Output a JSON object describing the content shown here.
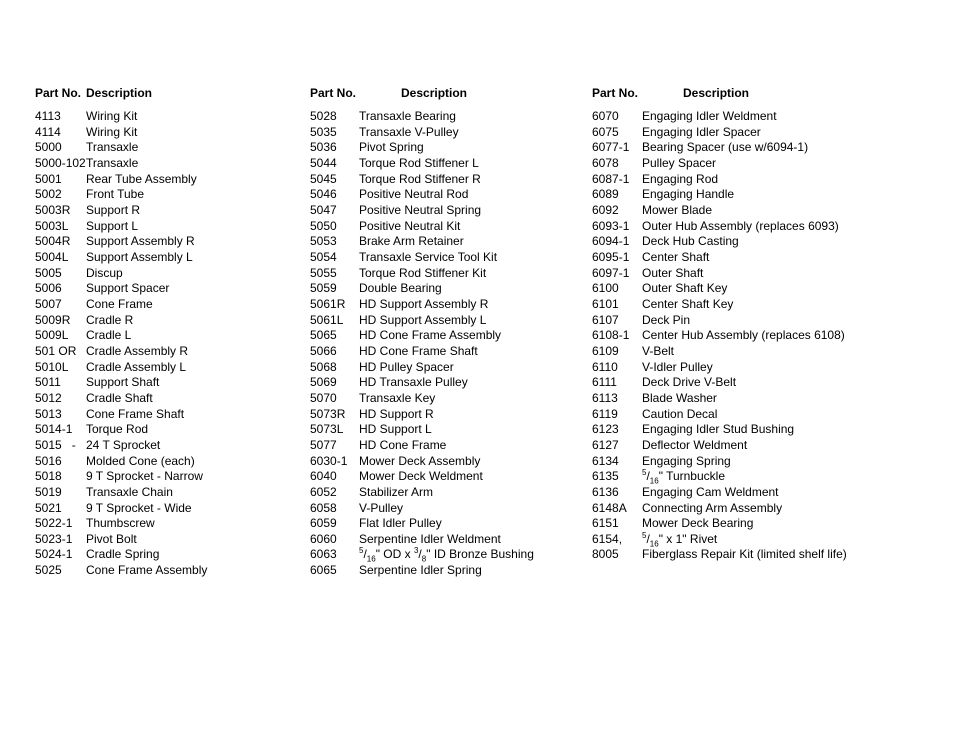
{
  "columns": [
    {
      "header_part": "Part No.",
      "header_desc": "Description",
      "rows": [
        {
          "part": "4113",
          "desc": "Wiring Kit"
        },
        {
          "part": "4114",
          "desc": "Wiring Kit"
        },
        {
          "part": "5000",
          "desc": "Transaxle"
        },
        {
          "part": "5000-102",
          "desc": "Transaxle"
        },
        {
          "part": "5001",
          "desc": "Rear Tube Assembly"
        },
        {
          "part": "5002",
          "desc": "Front Tube"
        },
        {
          "part": "5003R",
          "desc": "Support R"
        },
        {
          "part": "5003L",
          "desc": "Support L"
        },
        {
          "part": "5004R",
          "desc": "Support Assembly R"
        },
        {
          "part": "5004L",
          "desc": "Support Assembly L"
        },
        {
          "part": "5005",
          "desc": "Discup"
        },
        {
          "part": "5006",
          "desc": "Support Spacer"
        },
        {
          "part": "5007",
          "desc": "Cone Frame"
        },
        {
          "part": "5009R",
          "desc": "Cradle R"
        },
        {
          "part": "5009L",
          "desc": "Cradle L"
        },
        {
          "part": "501 OR",
          "desc": "Cradle Assembly R"
        },
        {
          "part": "5010L",
          "desc": "Cradle Assembly L"
        },
        {
          "part": "5011",
          "desc": "Support Shaft"
        },
        {
          "part": "5012",
          "desc": "Cradle Shaft"
        },
        {
          "part": "5013",
          "desc": "Cone Frame Shaft"
        },
        {
          "part": "5014-1",
          "desc": "Torque Rod"
        },
        {
          "part": "5015   -",
          "desc": "24 T Sprocket"
        },
        {
          "part": "5016",
          "desc": "Molded Cone (each)"
        },
        {
          "part": "5018",
          "desc": "9 T Sprocket - Narrow"
        },
        {
          "part": "5019",
          "desc": "Transaxle Chain"
        },
        {
          "part": "5021",
          "desc": "9 T Sprocket - Wide"
        },
        {
          "part": "5022-1",
          "desc": "Thumbscrew"
        },
        {
          "part": "5023-1",
          "desc": "Pivot Bolt"
        },
        {
          "part": "5024-1",
          "desc": "Cradle Spring"
        },
        {
          "part": "5025",
          "desc": "Cone Frame Assembly"
        }
      ]
    },
    {
      "header_part": "Part No.",
      "header_desc": "Description",
      "rows": [
        {
          "part": "5028",
          "desc": "Transaxle Bearing"
        },
        {
          "part": "5035",
          "desc": "Transaxle V-Pulley"
        },
        {
          "part": "5036",
          "desc": "Pivot Spring"
        },
        {
          "part": "5044",
          "desc": "Torque Rod Stiffener L"
        },
        {
          "part": "5045",
          "desc": "Torque Rod Stiffener R"
        },
        {
          "part": "5046",
          "desc": "Positive Neutral Rod"
        },
        {
          "part": "5047",
          "desc": "Positive Neutral Spring"
        },
        {
          "part": "5050",
          "desc": "Positive Neutral Kit"
        },
        {
          "part": "5053",
          "desc": "Brake Arm Retainer"
        },
        {
          "part": "5054",
          "desc": "Transaxle Service Tool Kit"
        },
        {
          "part": "5055",
          "desc": "Torque Rod Stiffener Kit"
        },
        {
          "part": "5059",
          "desc": "Double Bearing"
        },
        {
          "part": "5061R",
          "desc": "HD Support Assembly R"
        },
        {
          "part": "5061L",
          "desc": "HD Support Assembly L"
        },
        {
          "part": "5065",
          "desc": "HD Cone Frame Assembly"
        },
        {
          "part": "5066",
          "desc": "HD Cone Frame Shaft"
        },
        {
          "part": "5068",
          "desc": "HD Pulley Spacer"
        },
        {
          "part": "5069",
          "desc": "HD Transaxle Pulley"
        },
        {
          "part": "5070",
          "desc": "Transaxle Key"
        },
        {
          "part": "5073R",
          "desc": "HD Support R"
        },
        {
          "part": "5073L",
          "desc": "HD Support L"
        },
        {
          "part": "5077",
          "desc": "HD Cone Frame"
        },
        {
          "part": "6030-1",
          "desc": "Mower Deck Assembly"
        },
        {
          "part": "6040",
          "desc": "Mower Deck Weldment"
        },
        {
          "part": "6052",
          "desc": "Stabilizer Arm"
        },
        {
          "part": "6058",
          "desc": "V-Pulley"
        },
        {
          "part": "6059",
          "desc": "Flat Idler Pulley"
        },
        {
          "part": "6060",
          "desc": "Serpentine Idler Weldment"
        },
        {
          "part": "6063",
          "desc": "{5/16}\" OD x {3/8}\" ID Bronze Bushing"
        },
        {
          "part": "6065",
          "desc": "Serpentine Idler Spring"
        }
      ]
    },
    {
      "header_part": "Part No.",
      "header_desc": "Description",
      "rows": [
        {
          "part": "6070",
          "desc": "Engaging Idler Weldment"
        },
        {
          "part": "6075",
          "desc": "Engaging Idler Spacer"
        },
        {
          "part": "6077-1",
          "desc": "Bearing Spacer (use w/6094-1)"
        },
        {
          "part": "6078",
          "desc": "Pulley Spacer"
        },
        {
          "part": "6087-1",
          "desc": "Engaging Rod"
        },
        {
          "part": "6089",
          "desc": "Engaging Handle"
        },
        {
          "part": "6092",
          "desc": "Mower Blade"
        },
        {
          "part": "6093-1",
          "desc": "Outer Hub Assembly (replaces 6093)"
        },
        {
          "part": "6094-1",
          "desc": "Deck Hub Casting"
        },
        {
          "part": "6095-1",
          "desc": "Center Shaft"
        },
        {
          "part": "6097-1",
          "desc": "Outer Shaft"
        },
        {
          "part": "6100",
          "desc": "Outer Shaft Key"
        },
        {
          "part": "6101",
          "desc": "Center Shaft Key"
        },
        {
          "part": "6107",
          "desc": "Deck Pin"
        },
        {
          "part": "6108-1",
          "desc": "Center Hub Assembly (replaces 6108)"
        },
        {
          "part": "6109",
          "desc": "V-Belt"
        },
        {
          "part": "6110",
          "desc": "V-Idler Pulley"
        },
        {
          "part": "6111",
          "desc": "Deck Drive V-Belt"
        },
        {
          "part": "6113",
          "desc": "Blade Washer"
        },
        {
          "part": "6119",
          "desc": "Caution Decal"
        },
        {
          "part": "6123",
          "desc": "Engaging Idler Stud Bushing"
        },
        {
          "part": "6127",
          "desc": "Deflector Weldment"
        },
        {
          "part": "6134",
          "desc": "Engaging Spring"
        },
        {
          "part": "6135",
          "desc": "{5/16}\" Turnbuckle"
        },
        {
          "part": "6136",
          "desc": "Engaging Cam Weldment"
        },
        {
          "part": "6148A",
          "desc": "Connecting Arm Assembly"
        },
        {
          "part": "6151",
          "desc": "Mower Deck Bearing"
        },
        {
          "part": "6154,",
          "desc": "{5/16}\" x 1\" Rivet"
        },
        {
          "part": "8005",
          "desc": "Fiberglass Repair Kit (limited shelf life)"
        }
      ]
    }
  ]
}
